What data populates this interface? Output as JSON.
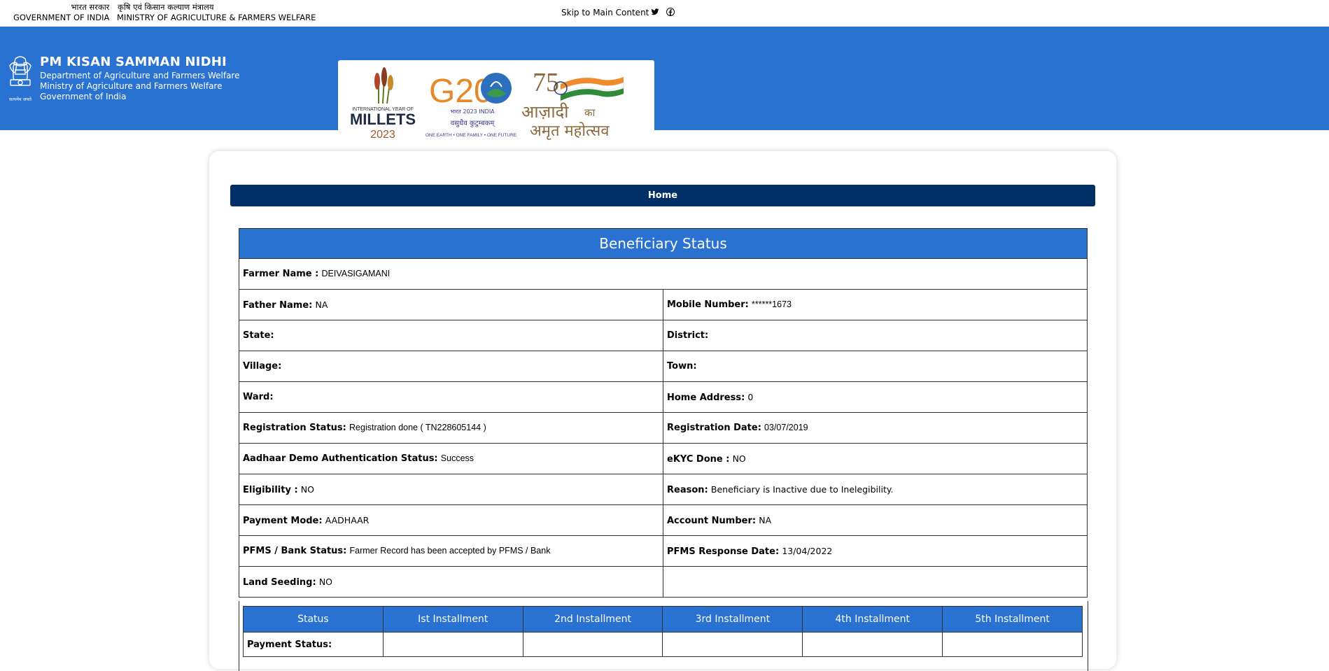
{
  "gov": {
    "left_hi": "भारत सरकार",
    "left_en": "GOVERNMENT OF INDIA",
    "right_hi": "कृषि एवं किसान कल्याण मंत्रालय",
    "right_en": "MINISTRY OF AGRICULTURE & FARMERS WELFARE",
    "skip": "Skip to Main Content",
    "social_icons": [
      "twitter-icon",
      "facebook-icon"
    ]
  },
  "header": {
    "title": "PM KISAN SAMMAN NIDHI",
    "sub1": "Department of Agriculture and Farmers Welfare",
    "sub2": "Ministry of Agriculture and Farmers Welfare",
    "sub3": "Government of India",
    "emblem_caption": "सत्यमेव जयते",
    "logos": {
      "millets_top": "INTERNATIONAL YEAR OF",
      "millets": "MILLETS",
      "millets_year": "2023",
      "g20": "G20",
      "g20_sub": "भारत 2023 INDIA",
      "g20_motto_hi": "वसुधैव कुटुम्बकम्",
      "g20_motto": "ONE EARTH • ONE FAMILY • ONE FUTURE",
      "azadi_1": "आज़ादी",
      "azadi_ka": "का",
      "azadi_2": "अमृत महोत्सव",
      "azadi_num": "75"
    }
  },
  "nav": {
    "home": "Home"
  },
  "status": {
    "title": "Beneficiary Status",
    "farmer_name_label": "Farmer Name :",
    "farmer_name": "DEIVASIGAMANI",
    "father_name_label": "Father Name:",
    "father_name": "NA",
    "mobile_label": "Mobile Number:",
    "mobile": "******1673",
    "state_label": "State:",
    "district_label": "District:",
    "village_label": "Village:",
    "town_label": "Town:",
    "ward_label": "Ward:",
    "home_address_label": "Home Address:",
    "home_address": "0",
    "reg_status_label": "Registration Status:",
    "reg_status": "Registration done ( TN228605144 )",
    "reg_date_label": "Registration Date:",
    "reg_date": "03/07/2019",
    "aadhaar_label": "Aadhaar Demo Authentication Status:",
    "aadhaar": "Success",
    "ekyc_label": "eKYC Done :",
    "ekyc": "NO",
    "eligibility_label": "Eligibility :",
    "eligibility": "NO",
    "reason_label": "Reason:",
    "reason": "Beneficiary is Inactive due to Inelegibility.",
    "payment_mode_label": "Payment Mode:",
    "payment_mode": "AADHAAR",
    "account_label": "Account Number:",
    "account": "NA",
    "pfms_label": "PFMS / Bank Status:",
    "pfms": "Farmer Record has been accepted by PFMS / Bank",
    "pfms_date_label": "PFMS Response Date:",
    "pfms_date": "13/04/2022",
    "land_label": "Land Seeding:",
    "land": "NO"
  },
  "installments": {
    "headers": [
      "Status",
      "Ist Installment",
      "2nd Installment",
      "3rd Installment",
      "4th Installment",
      "5th Installment"
    ],
    "payment_status_label": "Payment Status:"
  },
  "colors": {
    "header_blue": "#2a72d1",
    "nav_navy": "#003066"
  }
}
